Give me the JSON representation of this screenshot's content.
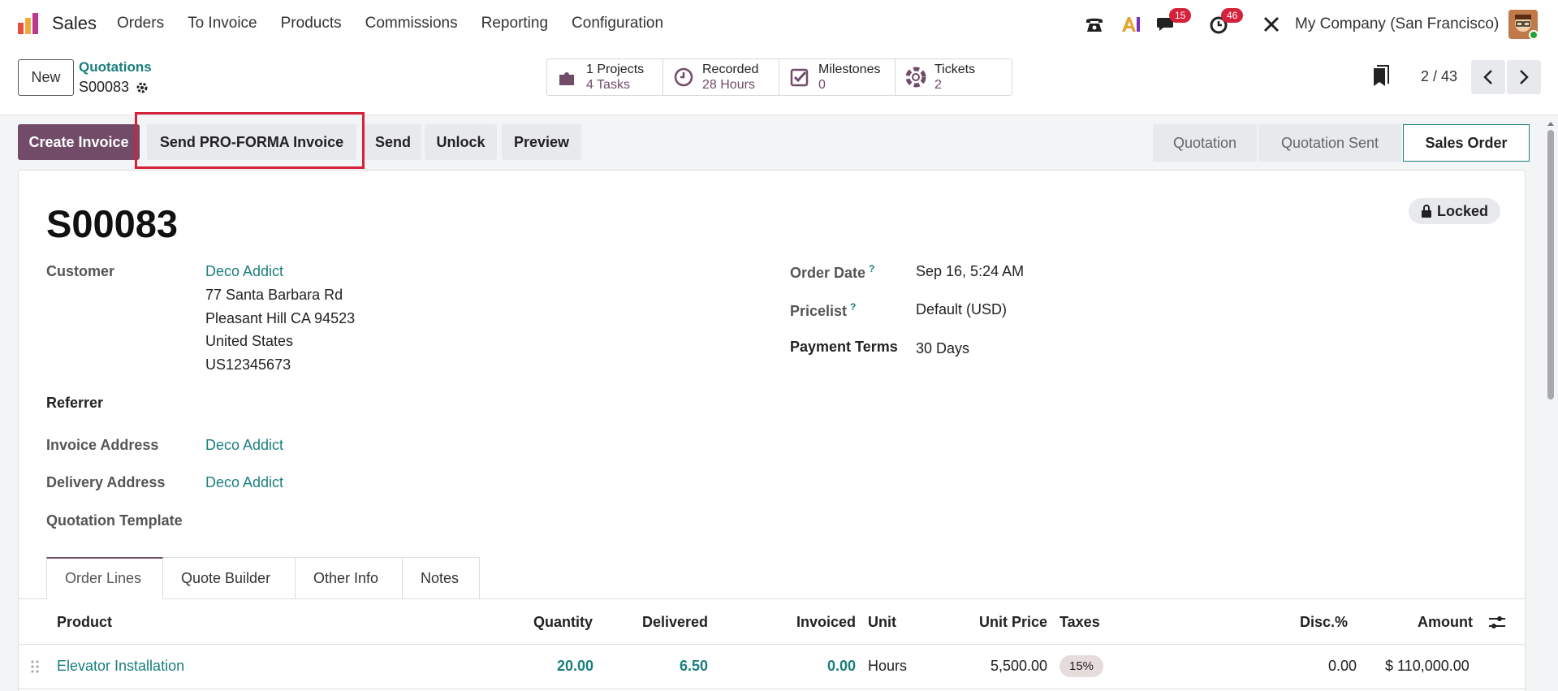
{
  "navbar": {
    "app_name": "Sales",
    "menu": [
      "Orders",
      "To Invoice",
      "Products",
      "Commissions",
      "Reporting",
      "Configuration"
    ],
    "chat_count": "15",
    "activity_count": "46",
    "company": "My Company (San Francisco)"
  },
  "control": {
    "new_label": "New",
    "breadcrumb_parent": "Quotations",
    "breadcrumb_current": "S00083",
    "stats": [
      {
        "line1": "1 Projects",
        "line2": "4 Tasks",
        "icon": "puzzle-icon"
      },
      {
        "line1": "Recorded",
        "line2": "28 Hours",
        "icon": "clock-icon"
      },
      {
        "line1": "Milestones",
        "line2": "0",
        "icon": "check-square-icon"
      },
      {
        "line1": "Tickets",
        "line2": "2",
        "icon": "lifebuoy-icon"
      }
    ],
    "pager": "2 / 43"
  },
  "actions": {
    "create_invoice": "Create Invoice",
    "send_proforma": "Send PRO-FORMA Invoice",
    "send": "Send",
    "unlock": "Unlock",
    "preview": "Preview",
    "statuses": [
      "Quotation",
      "Quotation Sent",
      "Sales Order"
    ],
    "active_status": "Sales Order"
  },
  "form": {
    "title": "S00083",
    "locked_label": "Locked",
    "customer_label": "Customer",
    "customer_name": "Deco Addict",
    "customer_address": [
      "77 Santa Barbara Rd",
      "Pleasant Hill CA 94523",
      "United States",
      "US12345673"
    ],
    "referrer_label": "Referrer",
    "invoice_address_label": "Invoice Address",
    "invoice_address": "Deco Addict",
    "delivery_address_label": "Delivery Address",
    "delivery_address": "Deco Addict",
    "quotation_template_label": "Quotation Template",
    "order_date_label": "Order Date",
    "order_date": "Sep 16, 5:24 AM",
    "pricelist_label": "Pricelist",
    "pricelist": "Default (USD)",
    "payment_terms_label": "Payment Terms",
    "payment_terms": "30 Days",
    "help_mark": "?"
  },
  "tabs": [
    "Order Lines",
    "Quote Builder",
    "Other Info",
    "Notes"
  ],
  "table": {
    "headers": [
      "Product",
      "Quantity",
      "Delivered",
      "Invoiced",
      "Unit",
      "Unit Price",
      "Taxes",
      "Disc.%",
      "Amount"
    ],
    "rows": [
      {
        "product": "Elevator Installation",
        "quantity": "20.00",
        "delivered": "6.50",
        "invoiced": "0.00",
        "unit": "Hours",
        "unit_price": "5,500.00",
        "taxes": "15%",
        "disc": "0.00",
        "amount": "$ 110,000.00"
      }
    ]
  },
  "colors": {
    "brand": "#714b67",
    "link": "#1a7e7e",
    "highlight": "#d5223a"
  }
}
